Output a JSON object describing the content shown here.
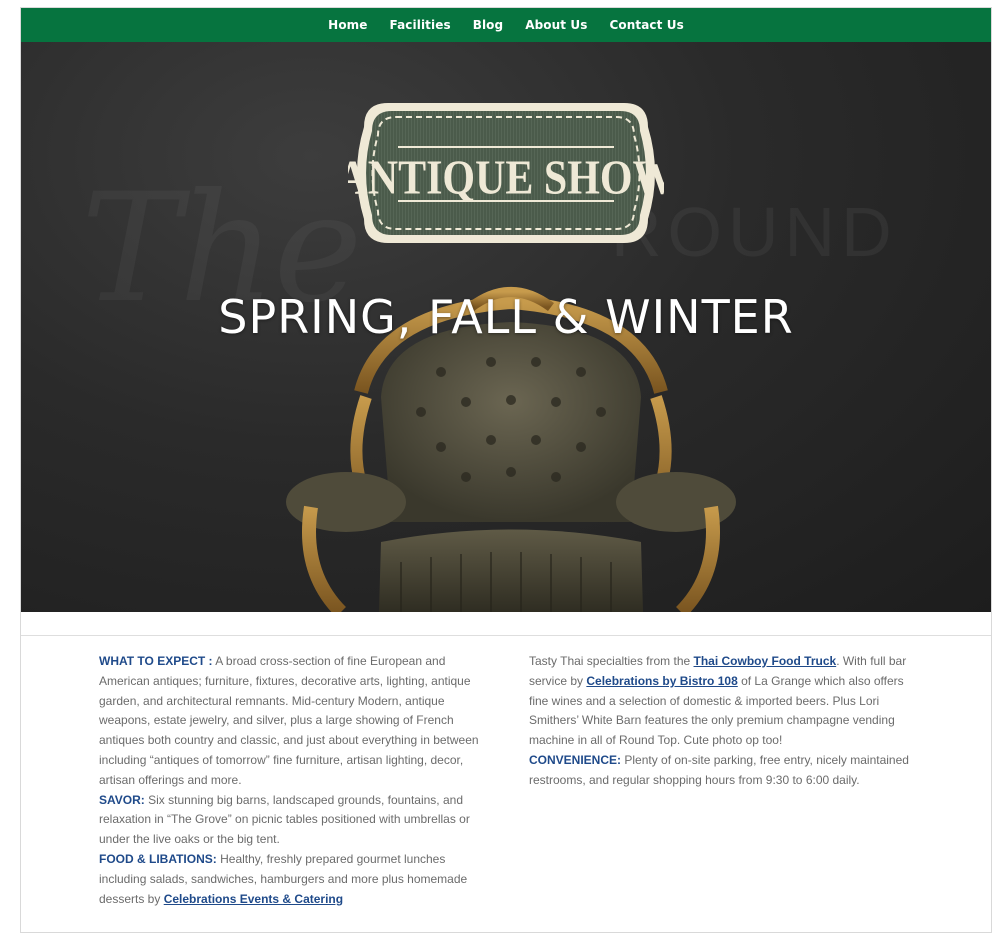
{
  "nav": {
    "items": [
      "Home",
      "Facilities",
      "Blog",
      "About Us",
      "Contact Us"
    ]
  },
  "hero": {
    "badge_text": "ANTIQUE SHOW",
    "headline": "SPRING, FALL & WINTER",
    "watermark_left": "The",
    "watermark_right": "ROUND"
  },
  "left": {
    "what_label": "WHAT TO EXPECT :",
    "what_text": " A broad cross-section of fine European and American antiques; furniture, fixtures, decorative arts, lighting, antique garden, and architectural remnants. Mid-century Modern, antique weapons, estate jewelry, and silver, plus a large showing of French antiques both country and classic, and just about everything in between including “antiques of tomorrow” fine furniture, artisan lighting, decor, artisan offerings and more.",
    "savor_label": "SAVOR:",
    "savor_text": " Six stunning big barns, landscaped grounds, fountains, and relaxation in “The Grove” on picnic tables positioned with umbrellas or under the live oaks or the big tent.",
    "food_label": "FOOD & LIBATIONS:",
    "food_text": " Healthy, freshly prepared gourmet lunches including salads, sandwiches, hamburgers and more plus homemade desserts by ",
    "food_link": "Celebrations Events & Catering"
  },
  "right": {
    "p1_a": "Tasty Thai specialties from the ",
    "p1_link1": "Thai Cowboy Food Truck",
    "p1_b": ". With full bar service by ",
    "p1_link2": "Celebrations by Bistro 108",
    "p1_c": " of La Grange which also offers fine wines and a selection of domestic & imported beers. Plus Lori Smithers’ White Barn features the only premium champagne vending machine in all of Round Top. Cute photo op too!",
    "conv_label": "CONVENIENCE:",
    "conv_text": " Plenty of on-site parking, free entry, nicely maintained restrooms, and regular shopping hours from 9:30 to 6:00 daily."
  },
  "colors": {
    "nav_bg": "#06743f",
    "accent_blue": "#1f4a8a",
    "badge_green": "#4a5a4a",
    "badge_cream": "#efe9d6"
  }
}
